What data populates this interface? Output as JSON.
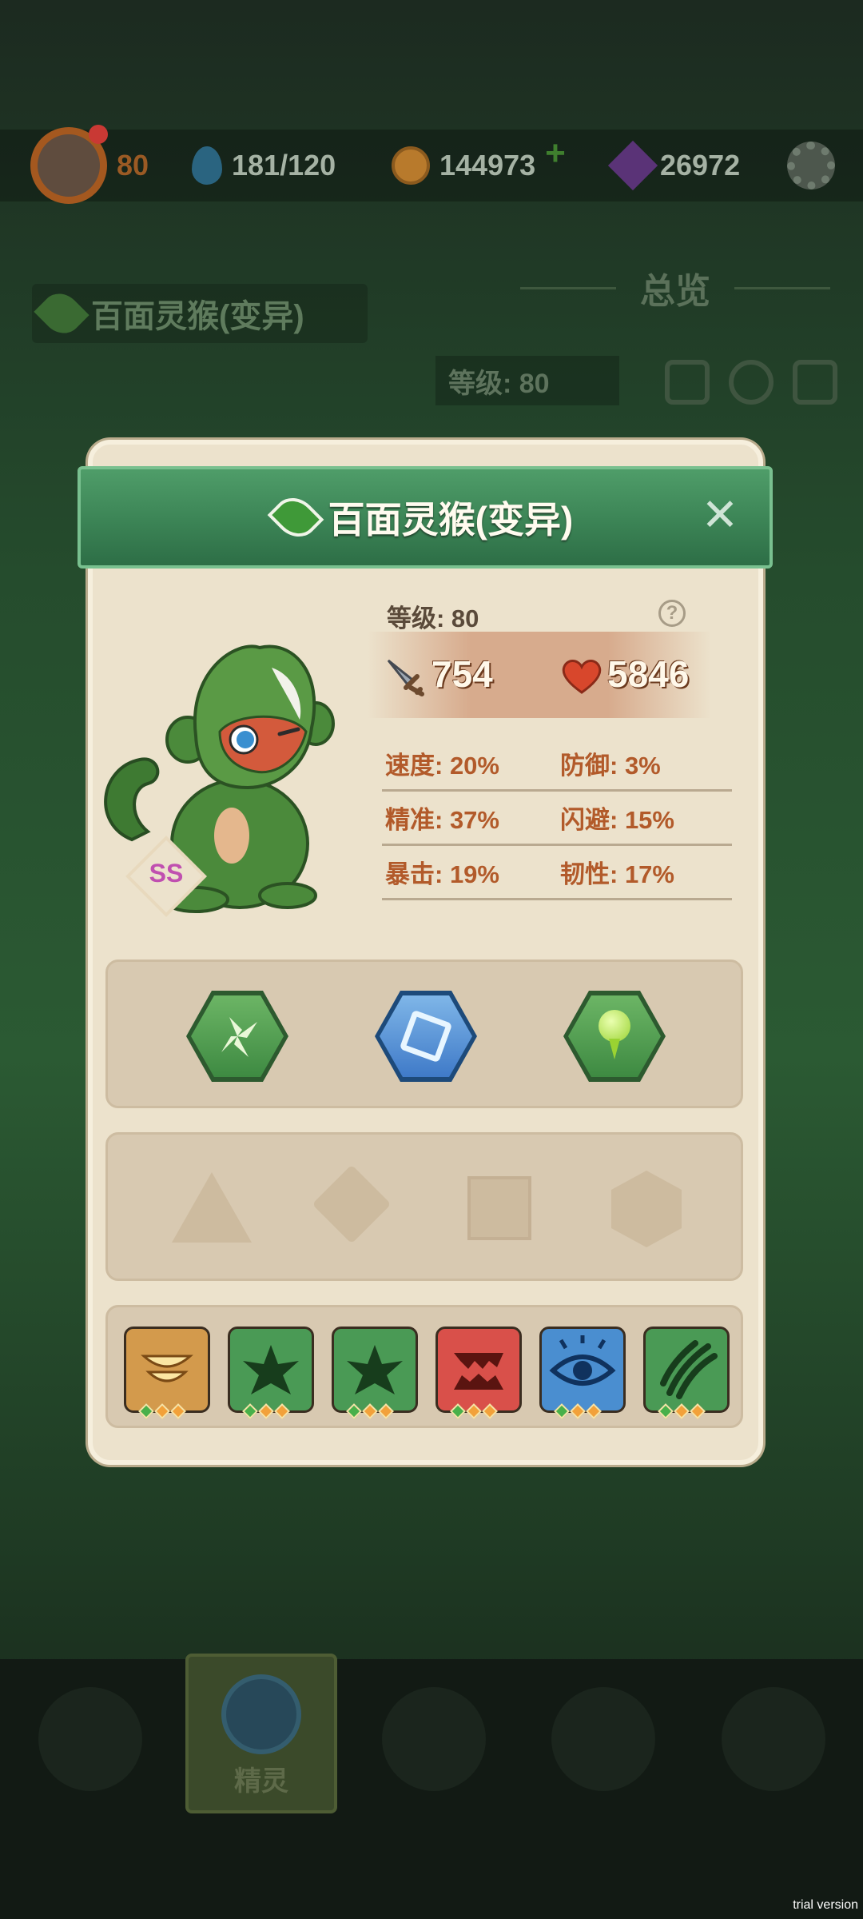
{
  "topbar": {
    "avatar_level": "80",
    "energy": "181/120",
    "coins": "144973",
    "coin_plus": "+",
    "gems": "26972"
  },
  "background": {
    "pet_name": "百面灵猴(变异)",
    "overview_title": "总览",
    "level_text": "等级: 80",
    "nav_selected_label": "精灵"
  },
  "modal": {
    "title": "百面灵猴(变异)",
    "close_label": "✕",
    "level_text": "等级: 80",
    "help_label": "?",
    "rank_badge": "SS",
    "attack": "754",
    "hp": "5846",
    "stats": [
      [
        {
          "label": "速度: ",
          "value": "20%"
        },
        {
          "label": "防御: ",
          "value": "3%"
        }
      ],
      [
        {
          "label": "精准: ",
          "value": "37%"
        },
        {
          "label": "闪避: ",
          "value": "15%"
        }
      ],
      [
        {
          "label": "暴击: ",
          "value": "19%"
        },
        {
          "label": "韧性: ",
          "value": "17%"
        }
      ]
    ],
    "traits": [
      "whirlwind-icon",
      "frost-crystal-icon",
      "leaf-drop-icon"
    ],
    "slots": [
      "triangle-slot",
      "diamond-slot",
      "square-slot",
      "hexagon-slot"
    ],
    "skills": [
      {
        "icon": "golden-bowl-icon",
        "color": "#d39a4c"
      },
      {
        "icon": "thorn-burst-icon",
        "color": "#4a9a55"
      },
      {
        "icon": "thorn-burst-icon",
        "color": "#4a9a55"
      },
      {
        "icon": "fang-bite-icon",
        "color": "#d9504a"
      },
      {
        "icon": "eye-icon",
        "color": "#4a8ed0"
      },
      {
        "icon": "claw-slash-icon",
        "color": "#4a9a55"
      }
    ]
  },
  "watermark": "trial version"
}
